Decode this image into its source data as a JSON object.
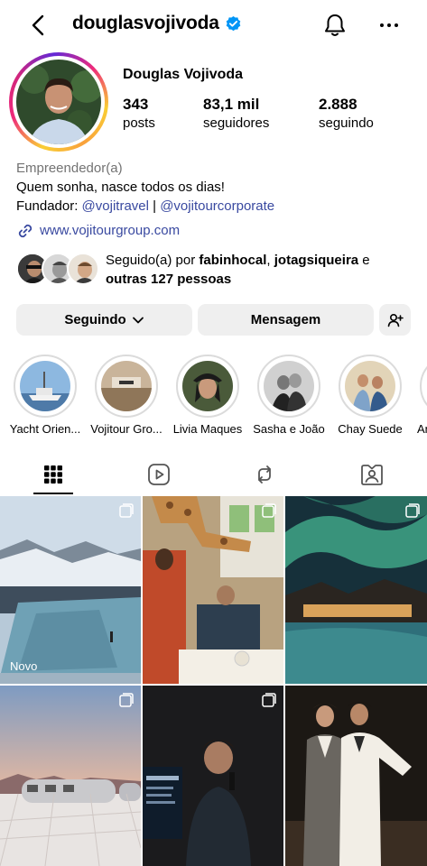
{
  "header": {
    "username": "douglasvojivoda",
    "back_icon": "chevron-left-icon",
    "verified_icon": "verified-badge-icon",
    "bell_icon": "bell-icon",
    "more_icon": "more-horizontal-icon"
  },
  "profile": {
    "full_name": "Douglas Vojivoda",
    "stats": [
      {
        "value": "343",
        "label": "posts"
      },
      {
        "value": "83,1 mil",
        "label": "seguidores"
      },
      {
        "value": "2.888",
        "label": "seguindo"
      }
    ],
    "category": "Empreendedor(a)",
    "bio_line": "Quem sonha, nasce todos os dias!",
    "founder_prefix": "Fundador: ",
    "mention_1": "@vojitravel",
    "separator": " | ",
    "mention_2": "@vojitourcorporate",
    "link_icon": "link-icon",
    "website": "www.vojitourgroup.com"
  },
  "followed_by": {
    "prefix": "Seguido(a) por ",
    "user_1": "fabinhocal",
    "comma": ", ",
    "user_2": "jotagsiqueira",
    "conj": " e",
    "others": "outras 127 pessoas"
  },
  "actions": {
    "following_label": "Seguindo",
    "message_label": "Mensagem",
    "add_user_icon": "add-user-icon"
  },
  "highlights": [
    {
      "label": "Yacht Orien..."
    },
    {
      "label": "Vojitour Gro..."
    },
    {
      "label": "Livia Maques"
    },
    {
      "label": "Sasha e João"
    },
    {
      "label": "Chay Suede"
    },
    {
      "label": "An"
    }
  ],
  "tabs": [
    {
      "icon": "grid-icon"
    },
    {
      "icon": "reels-icon"
    },
    {
      "icon": "reposts-icon"
    },
    {
      "icon": "tagged-icon"
    }
  ],
  "posts": [
    {
      "badge": "Novo"
    }
  ],
  "colors": {
    "link": "#3949a0",
    "verified": "#0095f6",
    "button_bg": "#efefef",
    "muted": "#737373"
  }
}
